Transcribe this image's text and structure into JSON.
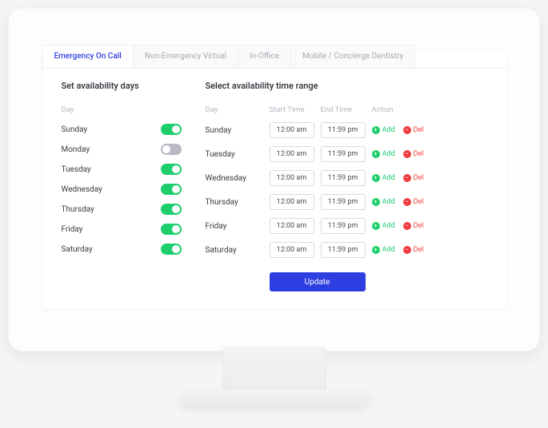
{
  "tabs": [
    {
      "label": "Emergency On Call",
      "active": true
    },
    {
      "label": "Non-Emergency Virtual",
      "active": false
    },
    {
      "label": "In-Office",
      "active": false
    },
    {
      "label": "Mobile / Concierge Dentistry",
      "active": false
    }
  ],
  "left": {
    "title": "Set availability days",
    "header": "Day",
    "days": [
      {
        "name": "Sunday",
        "on": true
      },
      {
        "name": "Monday",
        "on": false
      },
      {
        "name": "Tuesday",
        "on": true
      },
      {
        "name": "Wednesday",
        "on": true
      },
      {
        "name": "Thursday",
        "on": true
      },
      {
        "name": "Friday",
        "on": true
      },
      {
        "name": "Saturday",
        "on": true
      }
    ]
  },
  "right": {
    "title": "Select availability time range",
    "headers": {
      "day": "Day",
      "start": "Start Time",
      "end": "End Time",
      "action": "Action"
    },
    "rows": [
      {
        "day": "Sunday",
        "start": "12:00 am",
        "end": "11:59 pm"
      },
      {
        "day": "Tuesday",
        "start": "12:00 am",
        "end": "11:59 pm"
      },
      {
        "day": "Wednesday",
        "start": "12:00 am",
        "end": "11:59 pm"
      },
      {
        "day": "Thursday",
        "start": "12:00 am",
        "end": "11:59 pm"
      },
      {
        "day": "Friday",
        "start": "12:00 am",
        "end": "11:59 pm"
      },
      {
        "day": "Saturday",
        "start": "12:00 am",
        "end": "11:59 pm"
      }
    ],
    "add_label": "Add",
    "del_label": "Del",
    "update_label": "Update"
  }
}
